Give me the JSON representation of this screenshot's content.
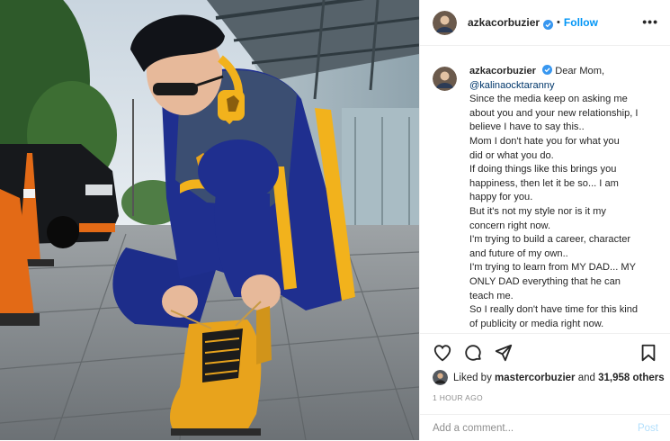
{
  "header": {
    "username": "azkacorbuzier",
    "separator": "•",
    "follow_label": "Follow",
    "more_label": "•••"
  },
  "caption": {
    "username": "azkacorbuzier",
    "lines": [
      "Dear Mom,",
      "@kalinaocktaranny",
      "Since the media keep on asking me",
      "about you and your new relationship, I",
      "believe I have to say this..",
      "Mom I don't hate you for what you",
      "did or what you do.",
      "If doing things like this brings you",
      "happiness, then let it be so... I am",
      "happy for you.",
      "But it's not my style nor is it my",
      "concern right now.",
      "I'm trying to build a career, character",
      "and future of my own..",
      "I'm trying to learn from MY DAD... MY",
      "ONLY DAD everything that he can",
      "teach me.",
      "So I really don't have time for this kind",
      "of publicity or media right now."
    ]
  },
  "actions": {
    "icons": [
      "heart-icon",
      "comment-icon",
      "share-icon",
      "bookmark-icon"
    ]
  },
  "likes": {
    "prefix": "Liked by",
    "liker": "mastercorbuzier",
    "joiner": "and",
    "others": "31,958 others"
  },
  "timestamp": "1 HOUR AGO",
  "comment_box": {
    "placeholder": "Add a comment...",
    "post_label": "Post"
  },
  "colors": {
    "accent": "#0095f6",
    "verified": "#3897f0",
    "post_disabled": "#b2dffc",
    "secondary_text": "#8e8e8e",
    "jacket": "#1f2f8f",
    "stripe": "#f2b21c",
    "shoe": "#e8a31c"
  }
}
